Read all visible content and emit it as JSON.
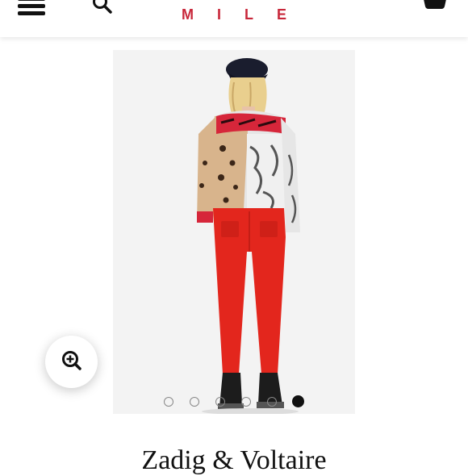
{
  "header": {
    "brand_letters": [
      "M",
      "I",
      "L",
      "E"
    ],
    "brand_color": "#c8273a",
    "icons": {
      "menu": "hamburger-menu-icon",
      "search": "search-icon",
      "cart": "shopping-bag-icon"
    }
  },
  "gallery": {
    "image_description": "model wearing red skinny jeans and patchwork animal-print sweater, viewed from behind",
    "slide_count": 6,
    "active_slide": 6
  },
  "zoom": {
    "icon": "zoom-in-icon"
  },
  "product": {
    "brand_name": "Zadig & Voltaire"
  }
}
